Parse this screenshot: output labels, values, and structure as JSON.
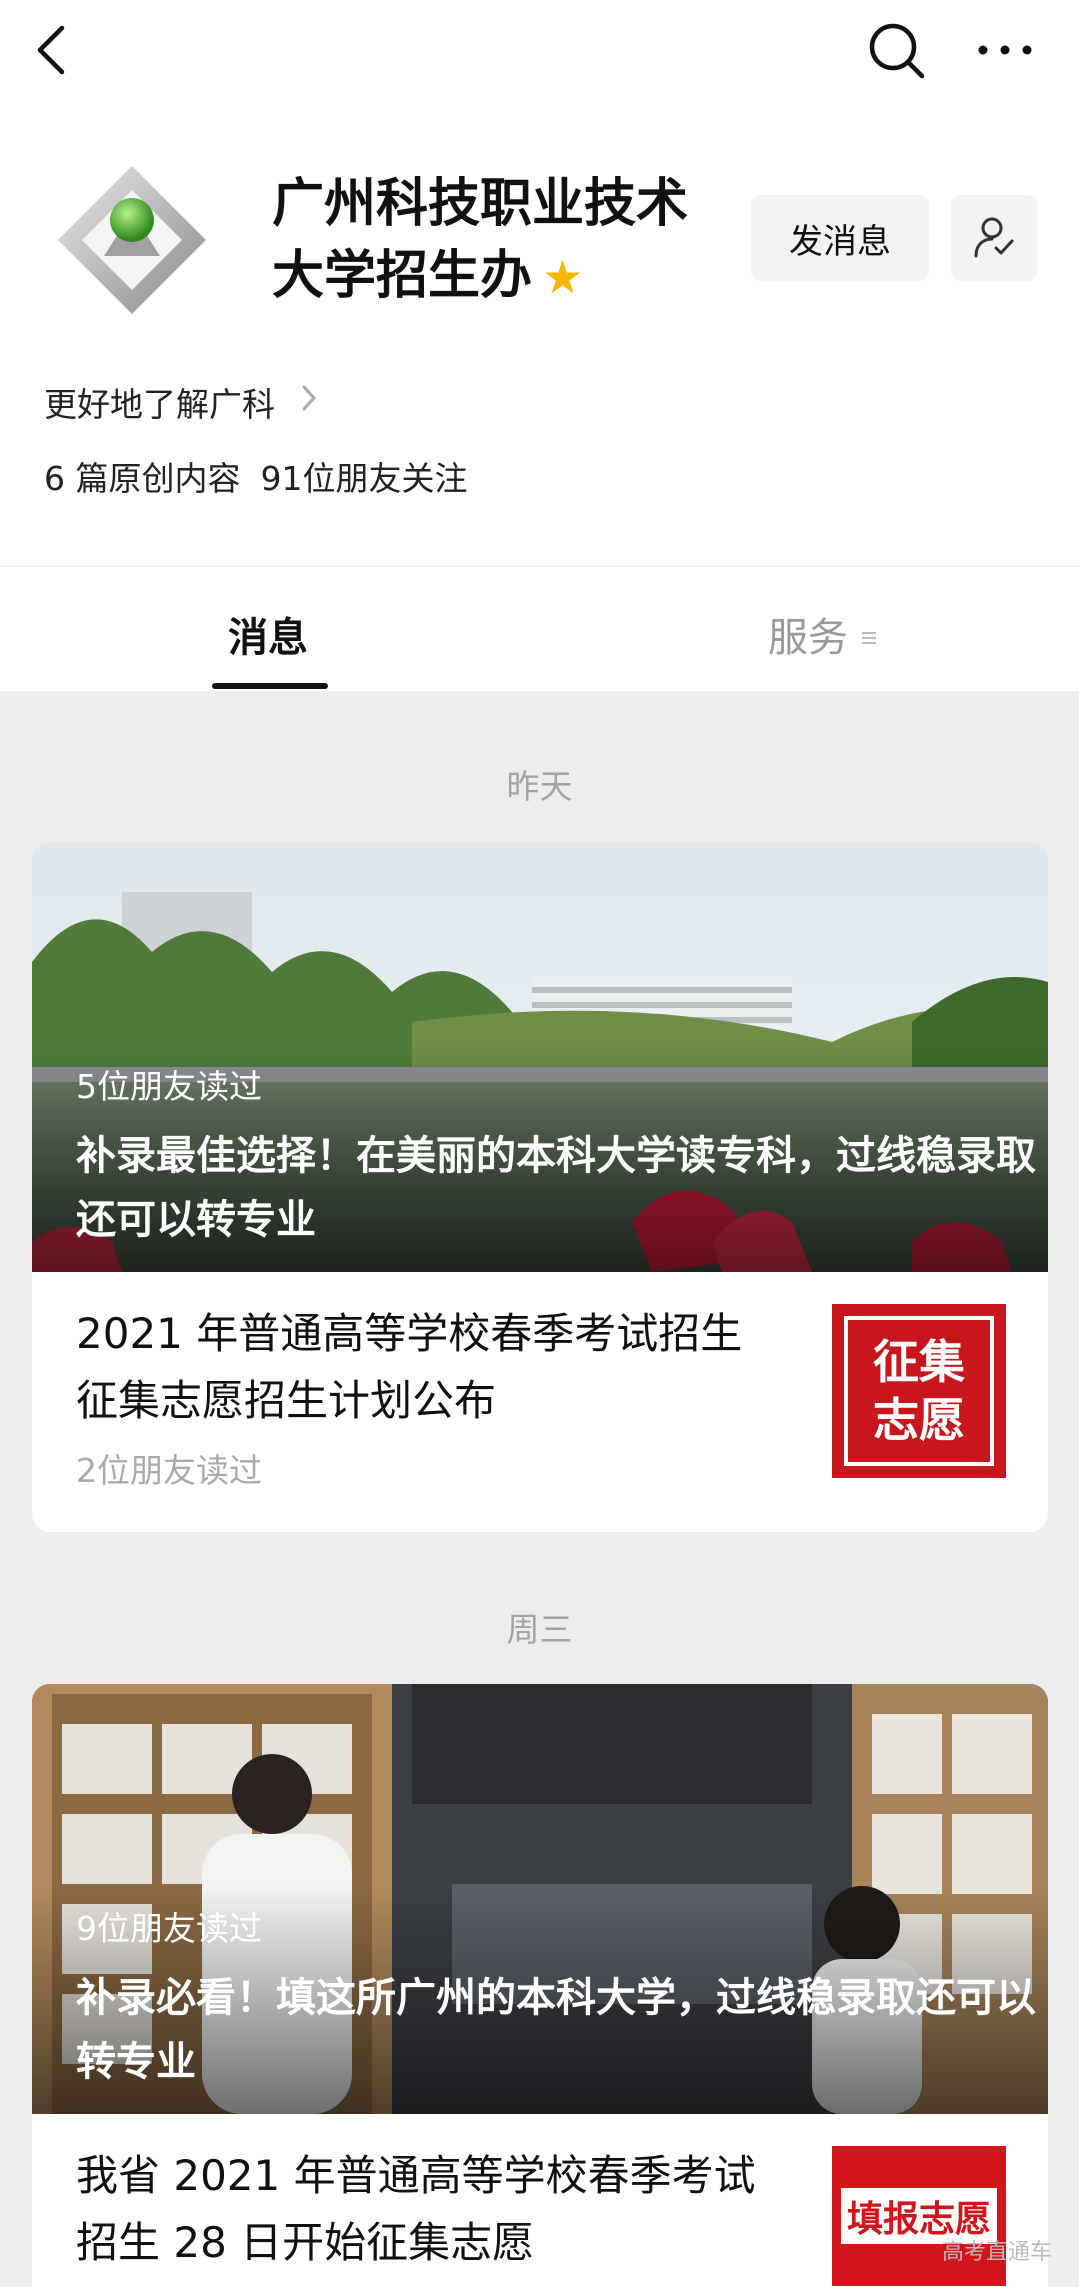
{
  "header": {
    "back_icon": "back-icon",
    "search_icon": "search-icon",
    "more_icon": "more-icon"
  },
  "profile": {
    "name_line1": "广州科技职业技术",
    "name_line2": "大学招生办",
    "star": "★",
    "message_button": "发消息",
    "about_link": "更好地了解广科",
    "stats_original": "6 篇原创内容",
    "stats_followers": "91位朋友关注"
  },
  "tabs": {
    "messages": "消息",
    "services": "服务"
  },
  "feed": [
    {
      "date": "昨天",
      "cover_readers": "5位朋友读过",
      "cover_headline": "补录最佳选择！在美丽的本科大学读专科，过线稳录取还可以转专业",
      "sub_title": "2021 年普通高等学校春季考试招生征集志愿招生计划公布",
      "sub_readers": "2位朋友读过",
      "thumb_text_1": "征集",
      "thumb_text_2": "志愿"
    },
    {
      "date": "周三",
      "cover_readers": "9位朋友读过",
      "cover_headline": "补录必看！填这所广州的本科大学，过线稳录取还可以转专业",
      "sub_title": "我省 2021 年普通高等学校春季考试招生 28 日开始征集志愿",
      "thumb_text": "填报志愿"
    }
  ],
  "watermark": "高考直通车",
  "colors": {
    "accent_star": "#f7b600",
    "thumb_red": "#c8161d",
    "background": "#ededed"
  }
}
